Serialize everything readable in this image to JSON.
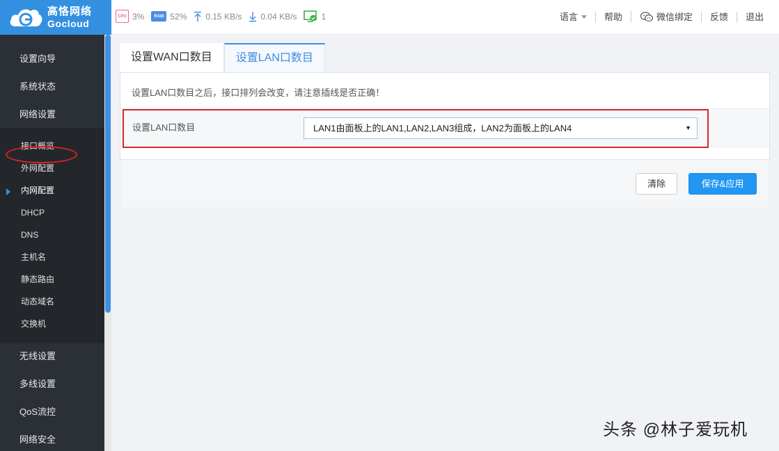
{
  "brand": {
    "name_cn": "高恪网络",
    "name_en": "Gocloud",
    "color": "#3390e0"
  },
  "status": {
    "cpu_label": "CPU",
    "cpu": "3%",
    "ram_label": "RAM",
    "ram": "52%",
    "upload": "0.15 KB/s",
    "download": "0.04 KB/s",
    "devices": "1"
  },
  "topnav": {
    "language": "语言",
    "help": "帮助",
    "wechat": "微信绑定",
    "feedback": "反馈",
    "logout": "退出"
  },
  "sidebar": {
    "main_top": [
      {
        "label": "设置向导"
      },
      {
        "label": "系统状态"
      },
      {
        "label": "网络设置"
      }
    ],
    "sub": [
      {
        "label": "接口概览"
      },
      {
        "label": "外网配置"
      },
      {
        "label": "内网配置"
      },
      {
        "label": "DHCP"
      },
      {
        "label": "DNS"
      },
      {
        "label": "主机名"
      },
      {
        "label": "静态路由"
      },
      {
        "label": "动态域名"
      },
      {
        "label": "交换机"
      }
    ],
    "main_bottom": [
      {
        "label": "无线设置"
      },
      {
        "label": "多线设置"
      },
      {
        "label": "QoS流控"
      },
      {
        "label": "网络安全"
      }
    ],
    "active_sub": "内网配置"
  },
  "tabs": [
    {
      "label": "设置WAN口数目"
    },
    {
      "label": "设置LAN口数目"
    }
  ],
  "form": {
    "notice": "设置LAN口数目之后，接口排列会改变，请注意插线是否正确！",
    "field_label": "设置LAN口数目",
    "select_value": "LAN1由面板上的LAN1,LAN2,LAN3组成，LAN2为面板上的LAN4"
  },
  "actions": {
    "clear": "清除",
    "save": "保存&应用"
  },
  "watermark": "头条 @林子爱玩机",
  "colors": {
    "accent": "#2196f3",
    "sidebar": "#2b3036",
    "highlight": "#d9262a"
  }
}
